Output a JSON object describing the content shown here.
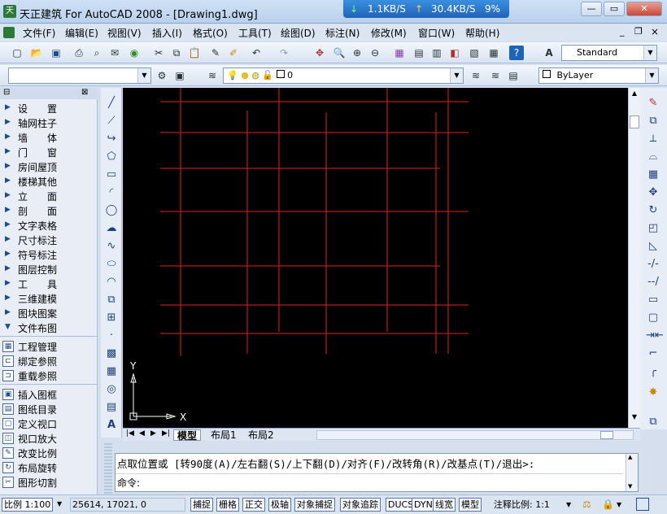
{
  "window": {
    "title": "天正建筑 For AutoCAD 2008 - [Drawing1.dwg]",
    "app_icon": "天"
  },
  "network_monitor": {
    "down": "1.1KB/S",
    "up": "30.4KB/S",
    "percent": "9%"
  },
  "window_controls": {
    "minimize": "—",
    "restore": "▭",
    "close": "✕"
  },
  "menu": [
    "文件(F)",
    "编辑(E)",
    "视图(V)",
    "插入(I)",
    "格式(O)",
    "工具(T)",
    "绘图(D)",
    "标注(N)",
    "修改(M)",
    "窗口(W)",
    "帮助(H)"
  ],
  "doc_controls": {
    "minimize": "_",
    "restore": "❐",
    "close": "×"
  },
  "toolbar": {
    "text_style": "Standard",
    "layer_value": "0",
    "linetype": "ByLayer"
  },
  "palette": {
    "groups": [
      "设　　置",
      "轴网柱子",
      "墙　　体",
      "门　　窗",
      "房间屋顶",
      "楼梯其他",
      "立　　面",
      "剖　　面",
      "文字表格",
      "尺寸标注",
      "符号标注",
      "图层控制",
      "工　　具",
      "三维建模",
      "图块图案",
      "文件布图"
    ],
    "tools": [
      "工程管理",
      "绑定参照",
      "重载参照",
      "插入图框",
      "图纸目录",
      "定义视口",
      "视口放大",
      "改变比例",
      "布局旋转",
      "图形切割"
    ]
  },
  "canvas": {
    "ucs_y": "Y",
    "ucs_x": "X"
  },
  "tabs": [
    "模型",
    "布局1",
    "布局2"
  ],
  "command": {
    "prompt_line": "点取位置或 [转90度(A)/左右翻(S)/上下翻(D)/对齐(F)/改转角(R)/改基点(T)/退出>:",
    "input_label": "命令:"
  },
  "status": {
    "scale": "比例 1:100",
    "coords": "25614, 17021, 0",
    "toggles": [
      "捕捉",
      "栅格",
      "正交",
      "极轴",
      "对象捕捉",
      "对象追踪",
      "DUCS",
      "DYN",
      "线宽",
      "模型"
    ],
    "annotation": "注释比例: 1:1"
  },
  "colors": {
    "grid_line": "#e02020",
    "canvas": "#000000"
  }
}
